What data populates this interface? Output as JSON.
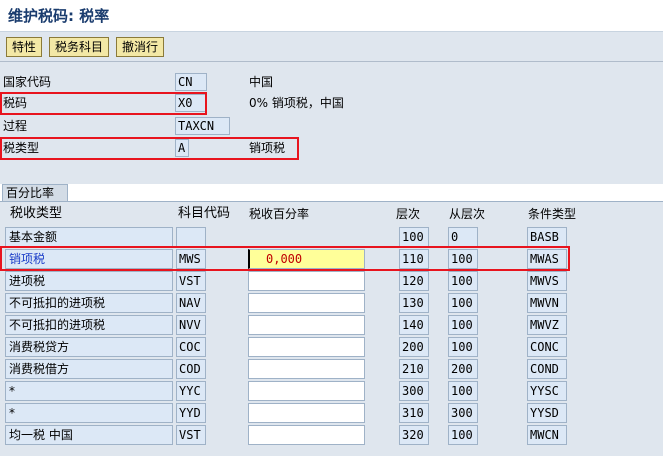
{
  "title": "维护税码: 税率",
  "toolbar": {
    "properties_label": "特性",
    "tax_accounts_label": "税务科目",
    "deactivate_label": "撤消行"
  },
  "header": {
    "country": {
      "label": "国家代码",
      "value": "CN",
      "desc": "中国"
    },
    "tax_code": {
      "label": "税码",
      "value": "X0",
      "desc": "0% 销项税，中国"
    },
    "procedure": {
      "label": "过程",
      "value": "TAXCN"
    },
    "tax_type": {
      "label": "税类型",
      "value": "A",
      "desc": "销项税"
    }
  },
  "tab": {
    "label": "百分比率"
  },
  "columns": {
    "tax_type": "税收类型",
    "account_key": "科目代码",
    "tax_percent": "税收百分率",
    "level": "层次",
    "from_level": "从层次",
    "condition_type": "条件类型"
  },
  "rows": [
    {
      "type": "基本金额",
      "key": "",
      "percent": null,
      "level": "100",
      "from": "0",
      "cond": "BASB"
    },
    {
      "type": "销项税",
      "key": "MWS",
      "percent": "0,000",
      "level": "110",
      "from": "100",
      "cond": "MWAS"
    },
    {
      "type": "进项税",
      "key": "VST",
      "percent": "",
      "level": "120",
      "from": "100",
      "cond": "MWVS"
    },
    {
      "type": "不可抵扣的进项税",
      "key": "NAV",
      "percent": "",
      "level": "130",
      "from": "100",
      "cond": "MWVN"
    },
    {
      "type": "不可抵扣的进项税",
      "key": "NVV",
      "percent": "",
      "level": "140",
      "from": "100",
      "cond": "MWVZ"
    },
    {
      "type": "消费税贷方",
      "key": "COC",
      "percent": "",
      "level": "200",
      "from": "100",
      "cond": "CONC"
    },
    {
      "type": "消费税借方",
      "key": "COD",
      "percent": "",
      "level": "210",
      "from": "200",
      "cond": "COND"
    },
    {
      "type": "*",
      "key": "YYC",
      "percent": "",
      "level": "300",
      "from": "100",
      "cond": "YYSC"
    },
    {
      "type": "*",
      "key": "YYD",
      "percent": "",
      "level": "310",
      "from": "300",
      "cond": "YYSD"
    },
    {
      "type": "均一税 中国",
      "key": "VST",
      "percent": "",
      "level": "320",
      "from": "100",
      "cond": "MWCN"
    }
  ],
  "colors": {
    "highlight_border": "#e8141e",
    "selected_text": "#1a3cc8",
    "input_highlight": "#ffff99"
  }
}
